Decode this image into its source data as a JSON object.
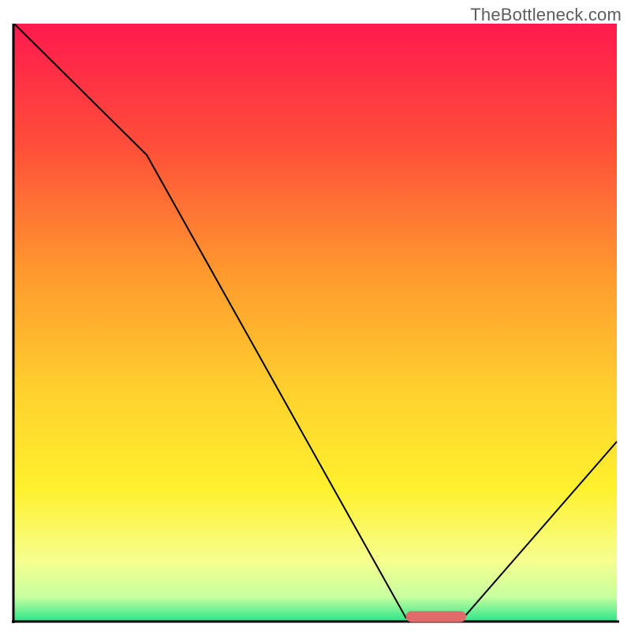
{
  "watermark": "TheBottleneck.com",
  "chart_data": {
    "type": "line",
    "title": "",
    "xlabel": "",
    "ylabel": "",
    "xlim": [
      0,
      100
    ],
    "ylim": [
      0,
      100
    ],
    "x": [
      0,
      3,
      22,
      65,
      70,
      75,
      100
    ],
    "y": [
      100,
      97,
      78,
      0.5,
      0.5,
      1,
      30
    ],
    "marker": {
      "range": [
        65,
        75
      ],
      "y": 0.7,
      "color": "#e16a6a"
    },
    "gradient_stops": [
      {
        "pct": 0,
        "color": "#ff1a4e"
      },
      {
        "pct": 20,
        "color": "#ff4d3a"
      },
      {
        "pct": 42,
        "color": "#ff9a2e"
      },
      {
        "pct": 62,
        "color": "#ffd22e"
      },
      {
        "pct": 78,
        "color": "#fff12e"
      },
      {
        "pct": 90,
        "color": "#f6ff8f"
      },
      {
        "pct": 96,
        "color": "#c8ffa0"
      },
      {
        "pct": 100,
        "color": "#2ee68b"
      }
    ],
    "axes": {
      "stroke": "#000000",
      "width": 3
    },
    "curve": {
      "stroke": "#000000",
      "width": 2
    }
  }
}
